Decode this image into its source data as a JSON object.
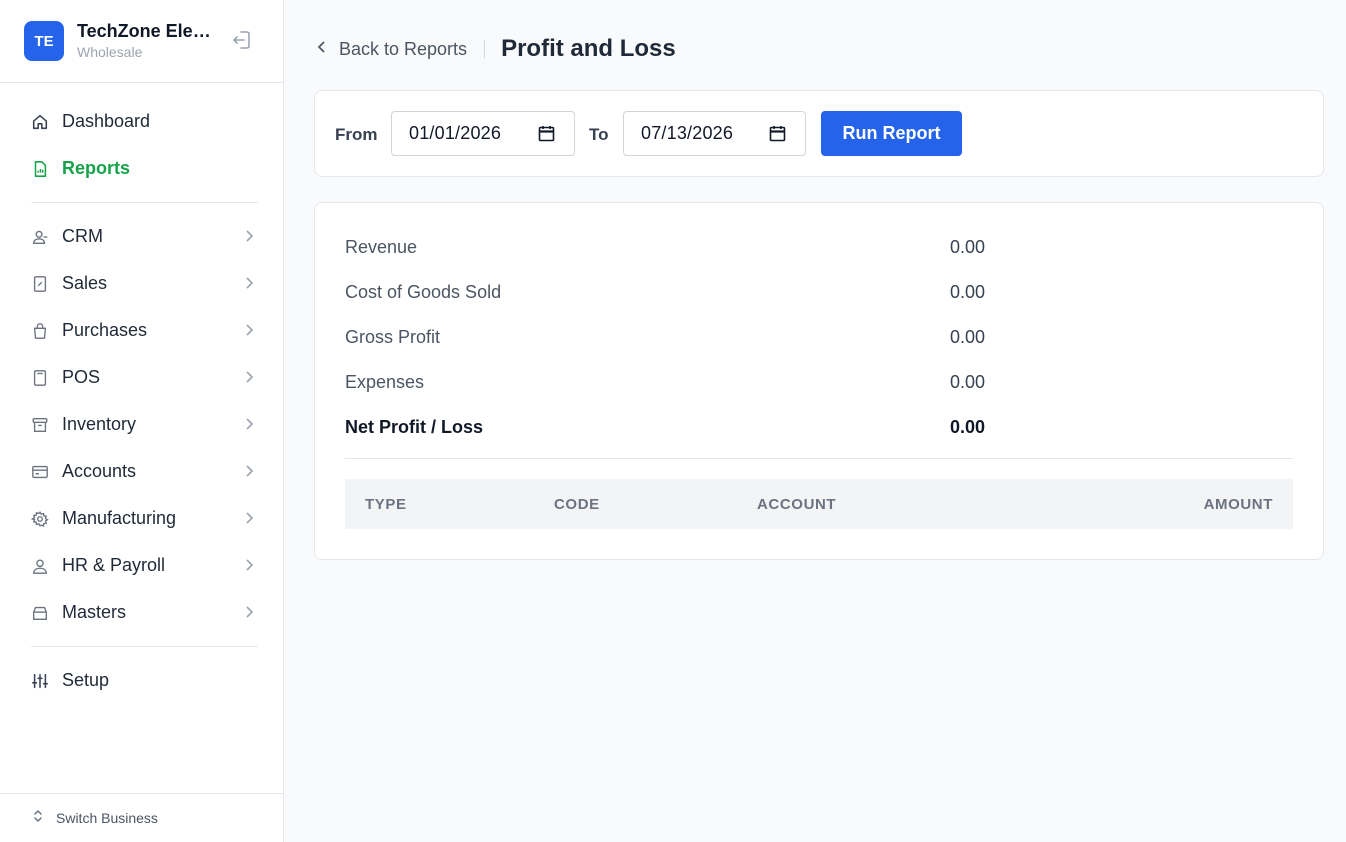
{
  "brand": {
    "initials": "TE",
    "name": "TechZone Electronics",
    "subtitle": "Wholesale"
  },
  "sidebar": {
    "items": [
      {
        "label": "Dashboard",
        "icon": "home-icon"
      },
      {
        "label": "Reports",
        "icon": "report-icon",
        "active": true
      },
      {
        "label": "CRM",
        "icon": "user-icon"
      },
      {
        "label": "Sales",
        "icon": "receipt-icon"
      },
      {
        "label": "Purchases",
        "icon": "bag-icon"
      },
      {
        "label": "POS",
        "icon": "calculator-icon"
      },
      {
        "label": "Inventory",
        "icon": "archive-icon"
      },
      {
        "label": "Accounts",
        "icon": "card-icon"
      },
      {
        "label": "Manufacturing",
        "icon": "gear-icon"
      },
      {
        "label": "HR & Payroll",
        "icon": "users-icon"
      },
      {
        "label": "Masters",
        "icon": "box-icon"
      },
      {
        "label": "Setup",
        "icon": "sliders-icon"
      }
    ],
    "switch_label": "Switch Business"
  },
  "header": {
    "back_label": "Back to Reports",
    "title": "Profit and Loss"
  },
  "filters": {
    "from_label": "From",
    "from_value": "01/01/2026",
    "to_label": "To",
    "to_value": "07/13/2026",
    "run_label": "Run Report"
  },
  "summary": {
    "rows": [
      {
        "label": "Revenue",
        "value": "0.00"
      },
      {
        "label": "Cost of Goods Sold",
        "value": "0.00"
      },
      {
        "label": "Gross Profit",
        "value": "0.00"
      },
      {
        "label": "Expenses",
        "value": "0.00"
      },
      {
        "label": "Net Profit / Loss",
        "value": "0.00"
      }
    ]
  },
  "table": {
    "columns": [
      "TYPE",
      "CODE",
      "ACCOUNT",
      "AMOUNT"
    ]
  },
  "colors": {
    "accent": "#2563eb",
    "active_nav": "#16a34a"
  }
}
